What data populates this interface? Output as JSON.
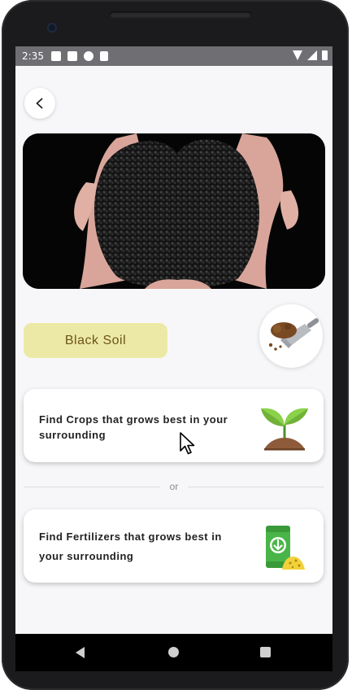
{
  "status_bar": {
    "time": "2:35",
    "left_icons": [
      "notification-icon",
      "notification-icon",
      "app-icon",
      "sd-card-icon"
    ],
    "right_icons": [
      "wifi-icon",
      "signal-icon",
      "battery-icon"
    ]
  },
  "header": {
    "back_icon": "chevron-left-icon"
  },
  "hero": {
    "image": "hands-holding-black-soil"
  },
  "soil": {
    "name": "Black Soil",
    "icon": "soil-scoop-icon"
  },
  "options": {
    "crops_label": "Find Crops that grows best in your surrounding",
    "crops_icon": "seedling-icon",
    "separator": "or",
    "fertilizers_label": "Find Fertilizers that grows best in your surrounding",
    "fertilizers_icon": "fertilizer-bag-icon"
  },
  "nav": {
    "icons": [
      "back-triangle-icon",
      "home-circle-icon",
      "recents-square-icon"
    ]
  },
  "colors": {
    "chip_bg": "#ece9a6",
    "chip_text": "#6d5416",
    "screen_bg": "#f7f7f9",
    "leaf_green": "#7cc53d",
    "bag_green": "#49b548"
  }
}
